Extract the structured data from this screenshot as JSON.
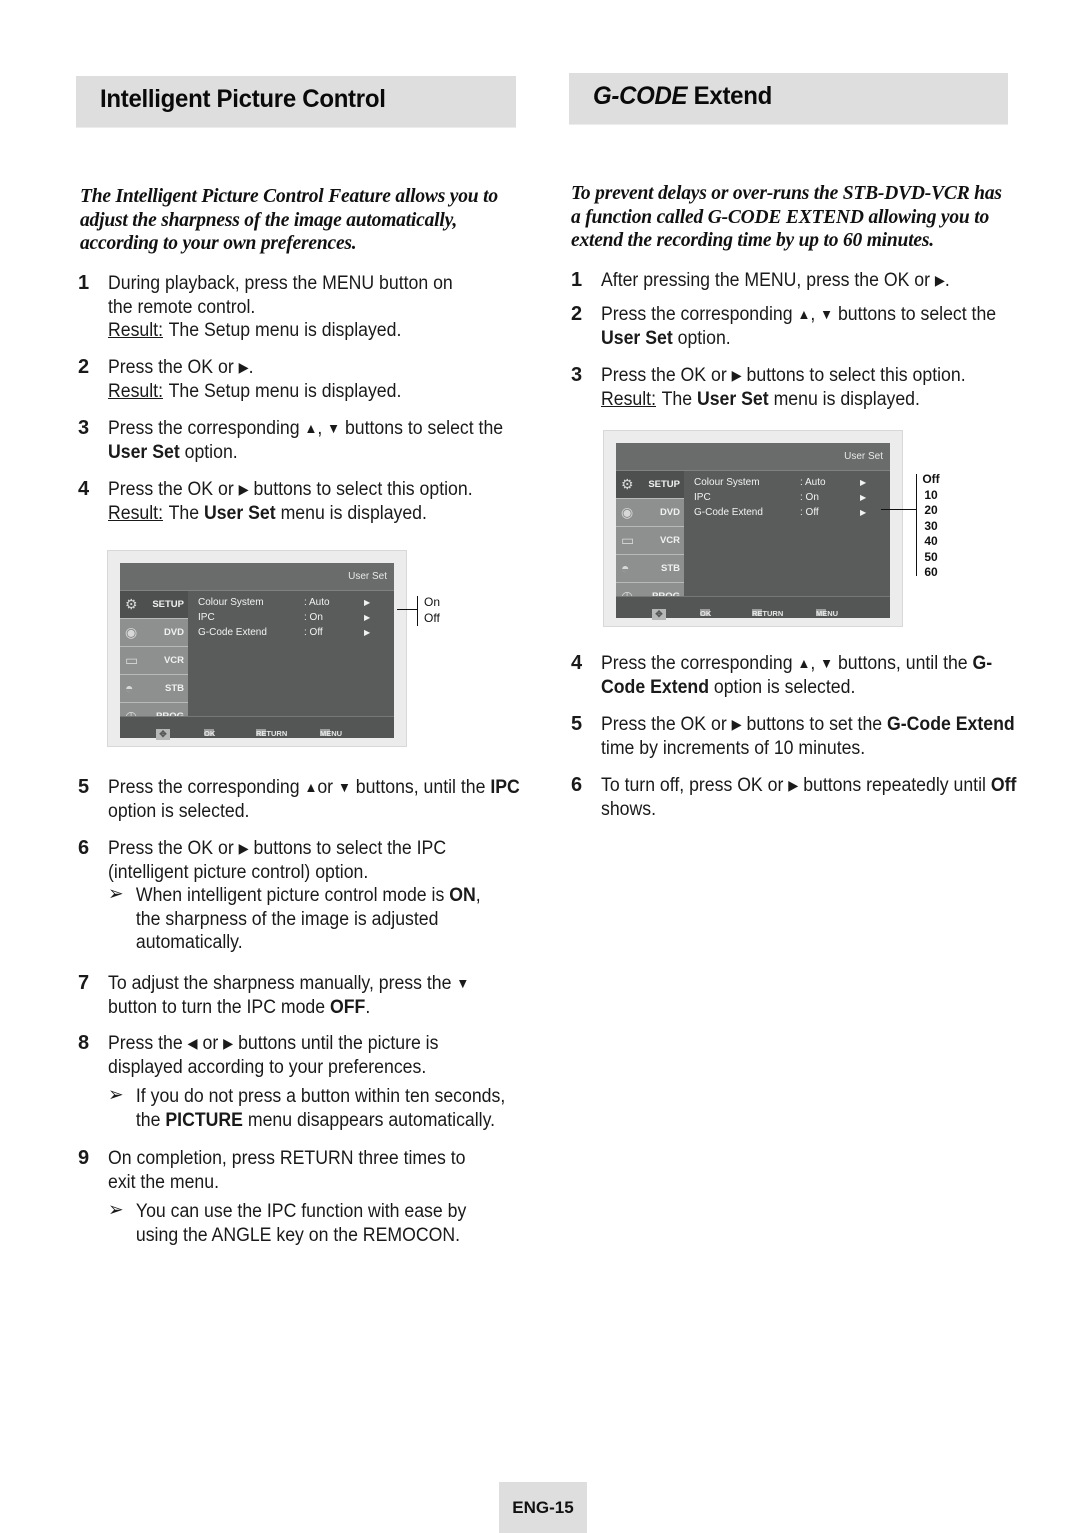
{
  "left": {
    "title": "Intelligent Picture Control",
    "intro": "The Intelligent Picture Control Feature allows you to adjust the sharpness of the image automatically, according to your own preferences.",
    "steps": [
      {
        "num": "1",
        "text": "During playback, press the MENU button on the remote control.",
        "result_label": "Result:",
        "result": "The Setup menu is displayed."
      },
      {
        "num": "2",
        "pre": "Press the OK or",
        "post": ".",
        "result_label": "Result:",
        "result": "The Setup menu is displayed."
      },
      {
        "num": "3",
        "pre": "Press the corresponding",
        "mid": "buttons to select the",
        "bold": "User Set",
        "post": "option."
      },
      {
        "num": "4",
        "pre": "Press the OK or",
        "mid": "buttons to select this option.",
        "result_label": "Result:",
        "result_pre": "The",
        "result_bold": "User Set",
        "result_post": "menu is displayed."
      },
      {
        "num": "5",
        "pre": "Press the corresponding",
        "or": "or",
        "mid": "buttons, until the",
        "bold": "IPC",
        "post": "option is selected."
      },
      {
        "num": "6",
        "pre": "Press the OK or",
        "mid": "buttons to select the IPC (intelligent picture control) option.",
        "note_pre": "When intelligent picture control mode is",
        "note_bold": "ON",
        "note_post": ", the sharpness of the image is adjusted automatically."
      },
      {
        "num": "7",
        "pre": "To adjust the sharpness manually, press the",
        "mid": "button to turn the IPC mode",
        "bold": "OFF",
        "post": "."
      },
      {
        "num": "8",
        "pre": "Press the",
        "or": "or",
        "mid": "buttons until the picture is displayed according to your preferences.",
        "note_pre": "If you do not press a button within ten seconds, the",
        "note_bold": "PICTURE",
        "note_post": "menu disappears automatically."
      },
      {
        "num": "9",
        "text": "On completion, press RETURN three times to exit the menu.",
        "note": "You can use the IPC function with ease by using the ANGLE key on the REMOCON."
      }
    ],
    "osd": {
      "crumb": "User Set",
      "sidebar": [
        "SETUP",
        "DVD",
        "VCR",
        "STB",
        "PROG"
      ],
      "rows": [
        {
          "key": "Colour  System",
          "value": ": Auto"
        },
        {
          "key": "IPC",
          "value": ": On"
        },
        {
          "key": "G-Code Extend",
          "value": ": Off"
        }
      ],
      "bottom": [
        "OK",
        "RETURN",
        "MENU"
      ],
      "callout_options": [
        "On",
        "Off"
      ]
    }
  },
  "right": {
    "title_italic": "G-CODE",
    "title_rest": "Extend",
    "intro": "To prevent delays or over-runs the STB-DVD-VCR has a function called G-CODE EXTEND allowing you to extend the recording time by up to 60 minutes.",
    "steps": [
      {
        "num": "1",
        "pre": "After pressing the MENU, press the OK or",
        "post": "."
      },
      {
        "num": "2",
        "pre": "Press the corresponding",
        "mid": "buttons to select the",
        "bold": "User Set",
        "post": "option."
      },
      {
        "num": "3",
        "pre": "Press the OK or",
        "mid": "buttons to select this option.",
        "result_label": "Result:",
        "result_pre": "The",
        "result_bold": "User Set",
        "result_post": "menu is displayed."
      },
      {
        "num": "4",
        "pre": "Press the corresponding",
        "mid": "buttons, until the",
        "bold": "G-Code Extend",
        "post": "option is selected."
      },
      {
        "num": "5",
        "pre": "Press the OK or",
        "mid": "buttons to set the",
        "bold": "G-Code Extend",
        "post": "time by increments of 10 minutes."
      },
      {
        "num": "6",
        "pre": "To turn off, press OK or",
        "mid": "buttons repeatedly until",
        "bold": "Off",
        "post": "shows."
      }
    ],
    "osd": {
      "crumb": "User Set",
      "sidebar": [
        "SETUP",
        "DVD",
        "VCR",
        "STB",
        "PROG"
      ],
      "rows": [
        {
          "key": "Colour  System",
          "value": ": Auto"
        },
        {
          "key": "IPC",
          "value": ": On"
        },
        {
          "key": "G-Code Extend",
          "value": ": Off"
        }
      ],
      "bottom": [
        "OK",
        "RETURN",
        "MENU"
      ],
      "callout_options": [
        "Off",
        "10",
        "20",
        "30",
        "40",
        "50",
        "60"
      ]
    }
  },
  "symbols": {
    "up": "▲",
    "down": "▼",
    "right": "▶",
    "left": "◀",
    "comma": ",",
    "note_arrow": "➢",
    "row_arrow": "▶"
  },
  "page_number": "ENG-15"
}
